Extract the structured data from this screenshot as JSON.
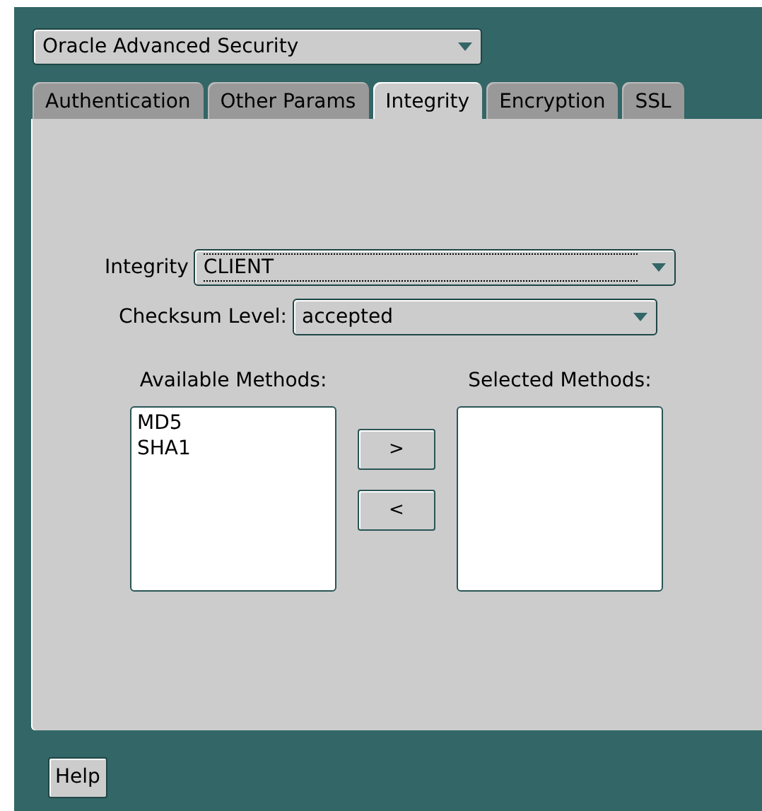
{
  "service_select": {
    "value": "Oracle Advanced Security"
  },
  "tabs": [
    {
      "label": "Authentication",
      "selected": false
    },
    {
      "label": "Other Params",
      "selected": false
    },
    {
      "label": "Integrity",
      "selected": true
    },
    {
      "label": "Encryption",
      "selected": false
    },
    {
      "label": "SSL",
      "selected": false
    }
  ],
  "integrity": {
    "label": "Integrity",
    "value": "CLIENT",
    "focused": true
  },
  "checksum_level": {
    "label": "Checksum Level:",
    "value": "accepted"
  },
  "available_methods": {
    "label": "Available Methods:",
    "items": [
      "MD5",
      "SHA1"
    ]
  },
  "move_buttons": [
    ">",
    "<"
  ],
  "selected_methods": {
    "label": "Selected Methods:"
  },
  "help_button": "Help"
}
